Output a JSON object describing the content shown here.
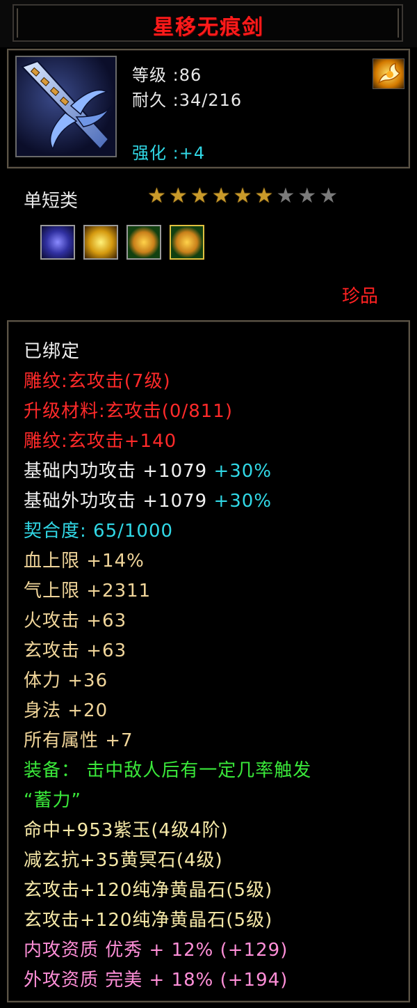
{
  "title": "星移无痕剑",
  "item": {
    "icon": "sword-icon",
    "level_text": "等级 :86",
    "durability_text": "耐久 :34/216",
    "enhance_text": "强化 :+4",
    "badge_icon": "golden-flame-badge-icon"
  },
  "category": "单短类",
  "stars": {
    "filled": 6,
    "total": 9
  },
  "gems": [
    "purple-jade-gem-icon",
    "yellow-crystal-gem-icon",
    "pure-yellow-crystal-gem-icon",
    "pure-yellow-crystal-gem-icon"
  ],
  "rarity": "珍品",
  "colors": {
    "red": "#ff2a2a",
    "cyan": "#31d8e6",
    "gold": "#f0d59a",
    "green": "#3ae83a",
    "pink": "#ff8fd8",
    "white": "#f0f0f0"
  },
  "attributes": [
    {
      "text": "已绑定",
      "color": "white"
    },
    {
      "text": "雕纹:玄攻击(7级)",
      "color": "red"
    },
    {
      "text": "升级材料:玄攻击(0/811)",
      "color": "red"
    },
    {
      "text": "雕纹:玄攻击+140",
      "color": "red"
    },
    {
      "text": "基础内功攻击 +1079",
      "extra": " +30%",
      "color": "white"
    },
    {
      "text": "基础外功攻击 +1079",
      "extra": " +30%",
      "color": "white"
    },
    {
      "text": "契合度: 65/1000",
      "color": "cyan"
    },
    {
      "text": "血上限 +14%",
      "color": "gold"
    },
    {
      "text": "气上限 +2311",
      "color": "gold"
    },
    {
      "text": "火攻击 +63",
      "color": "gold"
    },
    {
      "text": "玄攻击 +63",
      "color": "gold"
    },
    {
      "text": "体力 +36",
      "color": "gold"
    },
    {
      "text": "身法 +20",
      "color": "gold"
    },
    {
      "text": "所有属性 +7",
      "color": "gold"
    },
    {
      "text": "装备： 击中敌人后有一定几率触发",
      "color": "green"
    },
    {
      "text": "“蓄力”",
      "color": "green"
    },
    {
      "text": "命中+953紫玉(4级4阶)",
      "color": "lineyellow"
    },
    {
      "text": "减玄抗+35黄冥石(4级)",
      "color": "lineyellow"
    },
    {
      "text": "玄攻击+120纯净黄晶石(5级)",
      "color": "lineyellow"
    },
    {
      "text": "玄攻击+120纯净黄晶石(5级)",
      "color": "lineyellow"
    },
    {
      "text": "内攻资质 优秀 + 12% (+129)",
      "color": "pink"
    },
    {
      "text": "外攻资质 完美 + 18% (+194)",
      "color": "pink"
    }
  ]
}
